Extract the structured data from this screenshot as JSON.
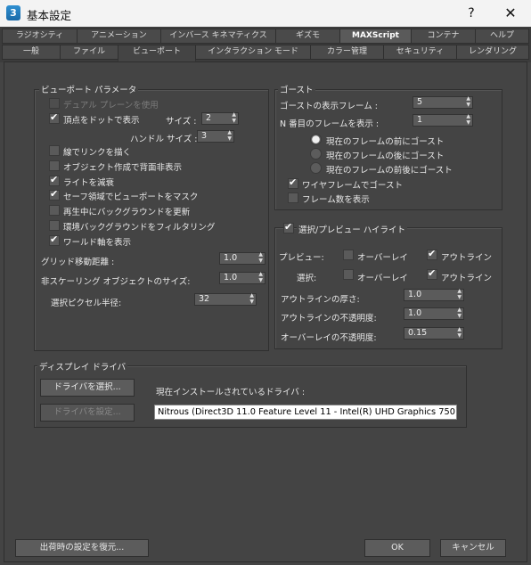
{
  "window": {
    "icon_text": "3",
    "title": "基本設定",
    "help": "?",
    "close": "✕"
  },
  "tabs_row1": [
    "ラジオシティ",
    "アニメーション",
    "インバース キネマティクス",
    "ギズモ",
    "MAXScript",
    "コンテナ",
    "ヘルプ"
  ],
  "tabs_row2": [
    "一般",
    "ファイル",
    "ビューポート",
    "インタラクション モード",
    "カラー管理",
    "セキュリティ",
    "レンダリング"
  ],
  "viewport_params": {
    "title": "ビューポート パラメータ",
    "dual_plane": "デュアル プレーンを使用",
    "dot_vertices": "頂点をドットで表示",
    "size_label": "サイズ :",
    "size_value": "2",
    "handle_size_label": "ハンドル サイズ :",
    "handle_size_value": "3",
    "draw_links": "線でリンクを描く",
    "backface_cull": "オブジェクト作成で背面非表示",
    "attenuate_lights": "ライトを減衰",
    "safe_frame_mask": "セーフ領域でビューポートをマスク",
    "update_bg": "再生中にバックグラウンドを更新",
    "filter_env_bg": "環境バックグラウンドをフィルタリング",
    "world_axis": "ワールド軸を表示",
    "grid_nudge_label": "グリッド移動距離 :",
    "grid_nudge_value": "1.0",
    "nonscaling_label": "非スケーリング オブジェクトのサイズ:",
    "nonscaling_value": "1.0",
    "pick_radius_label": "選択ピクセル半径:",
    "pick_radius_value": "32"
  },
  "ghosting": {
    "title": "ゴースト",
    "frames_label": "ゴーストの表示フレーム :",
    "frames_value": "5",
    "nth_label": "N 番目のフレームを表示 :",
    "nth_value": "1",
    "before": "現在のフレームの前にゴースト",
    "after": "現在のフレームの後にゴースト",
    "before_after": "現在のフレームの前後にゴースト",
    "wireframe": "ワイヤフレームでゴースト",
    "show_frame_num": "フレーム数を表示"
  },
  "highlight": {
    "title": "選択/プレビュー ハイライト",
    "preview_label": "プレビュー:",
    "overlay": "オーバーレイ",
    "outline": "アウトライン",
    "selection_label": "選択:",
    "outline_thickness_label": "アウトラインの厚さ:",
    "outline_thickness_value": "1.0",
    "outline_opacity_label": "アウトラインの不透明度:",
    "outline_opacity_value": "1.0",
    "overlay_opacity_label": "オーバーレイの不透明度:",
    "overlay_opacity_value": "0.15"
  },
  "display_driver": {
    "title": "ディスプレイ ドライバ",
    "choose_button": "ドライバを選択...",
    "configure_button": "ドライバを設定...",
    "installed_label": "現在インストールされているドライバ :",
    "installed_value": "Nitrous (Direct3D 11.0 Feature Level 11 - Intel(R) UHD Graphics 750)"
  },
  "footer": {
    "revert": "出荷時の設定を復元...",
    "ok": "OK",
    "cancel": "キャンセル"
  }
}
